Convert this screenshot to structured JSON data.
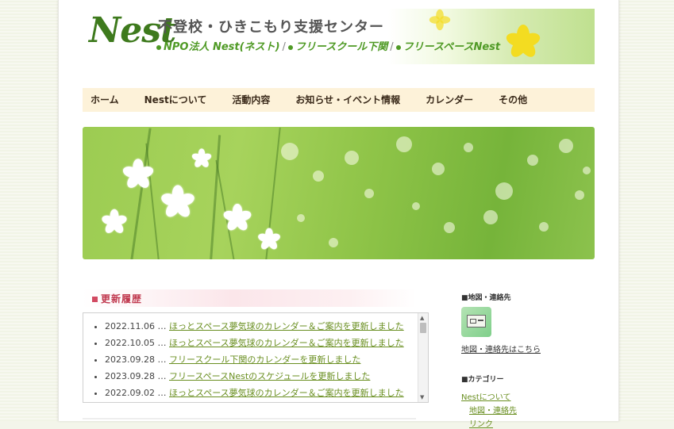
{
  "header": {
    "logo_main": "Nest",
    "title": "不登校・ひきこもり支援センター",
    "subtitles": [
      "NPO法人 Nest(ネスト)",
      "フリースクール下関",
      "フリースペースNest"
    ]
  },
  "nav": {
    "items": [
      "ホーム",
      "Nestについて",
      "活動内容",
      "お知らせ・イベント情報",
      "カレンダー",
      "その他"
    ]
  },
  "updates": {
    "heading": "更新履歴",
    "items": [
      {
        "date": "2022.11.06 …",
        "text": "ほっとスペース夢気球のカレンダー＆ご案内を更新しました"
      },
      {
        "date": "2022.10.05 …",
        "text": "ほっとスペース夢気球のカレンダー＆ご案内を更新しました"
      },
      {
        "date": "2023.09.28 …",
        "text": "フリースクール下関のカレンダーを更新しました"
      },
      {
        "date": "2023.09.28 …",
        "text": "フリースペースNestのスケジュールを更新しました"
      },
      {
        "date": "2022.09.02 …",
        "text": "ほっとスペース夢気球のカレンダー＆ご案内を更新しました"
      }
    ]
  },
  "sidebar": {
    "map_heading": "■地図・連絡先",
    "map_link": "地図・連絡先はこちら",
    "category_heading": "■カテゴリー",
    "categories": [
      "Nestについて",
      "地図・連絡先",
      "リンク"
    ]
  },
  "colors": {
    "nav_bg": "#fdf2d9",
    "link_green": "#6a8f21",
    "heading_pink": "#c0394f",
    "logo_green": "#3e7a1d"
  }
}
